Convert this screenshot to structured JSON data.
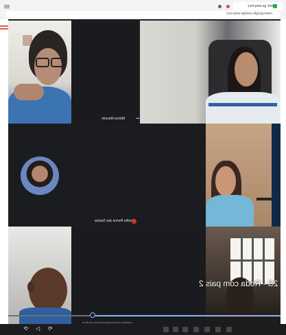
{
  "browser": {
    "tab_title": "Meet: gs-woq-mcz",
    "url": "meet.google.com/gs-woq-mcz"
  },
  "meet": {
    "participants": [
      {
        "name": "Márcia Macedo",
        "label": "Márcia Macedo"
      },
      {
        "name": "Jenifer Renne dos Santos",
        "label": "Jenifer Renne dos Santos"
      }
    ],
    "presentation_text": "2S - Roda com pais 2",
    "caption": "professor conversação parceria de aluno"
  },
  "player": {
    "progress_percent": 31,
    "controls": [
      "skip-back-icon",
      "play-icon",
      "skip-forward-icon"
    ]
  },
  "colors": {
    "meet_bg": "#202124",
    "accent": "#8ab4f8",
    "red_badge": "#d93025"
  }
}
